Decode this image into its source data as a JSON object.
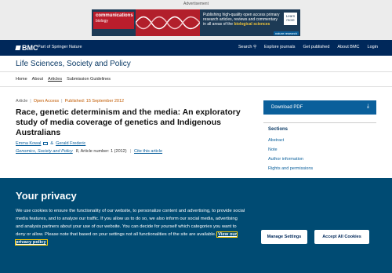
{
  "ad": {
    "label": "Advertisement",
    "brand_line1": "communications",
    "brand_line2": "biology",
    "copy_prefix": "Publishing high-quality open access primary research articles, reviews and commentary in all areas of the",
    "copy_highlight": "biological sciences",
    "learn": "Learn more",
    "search_label": "nature research"
  },
  "header": {
    "logo": "BMC",
    "part_of": "Part of Springer Nature",
    "nav": [
      "Search",
      "Explore journals",
      "Get published",
      "About BMC",
      "Login"
    ]
  },
  "journal": {
    "title": "Life Sciences, Society and Policy"
  },
  "breadcrumb": [
    "Home",
    "About",
    "Articles",
    "Submission Guidelines"
  ],
  "article": {
    "type": "Article",
    "access": "Open Access",
    "published": "Published: 15 September 2012",
    "title": "Race, genetic determinism and the media: An exploratory study of media coverage of genetics and Indigenous Australians",
    "author1": "Emma Kowal",
    "author_sep": "&",
    "author2": "Gerald Frederic",
    "journal_name": "Genomics, Society and Policy",
    "volume_info": "8, Article number: 1 (2012)",
    "cite": "Cite this article"
  },
  "sidebar": {
    "download": "Download PDF",
    "sections_heading": "Sections",
    "sections": [
      "Abstract",
      "Note",
      "Author information",
      "Rights and permissions"
    ]
  },
  "cookie": {
    "title": "Your privacy",
    "text": "We use cookies to ensure the functionality of our website, to personalize content and advertising, to provide social media features, and to analyze our traffic. If you allow us to do so, we also inform our social media, advertising and analysis partners about your use of our website. You can decide for yourself which categories you want to deny or allow. Please note that based on your settings not all functionalities of the site are available.",
    "link": "View our privacy policy",
    "manage": "Manage Settings",
    "accept": "Accept All Cookies"
  }
}
